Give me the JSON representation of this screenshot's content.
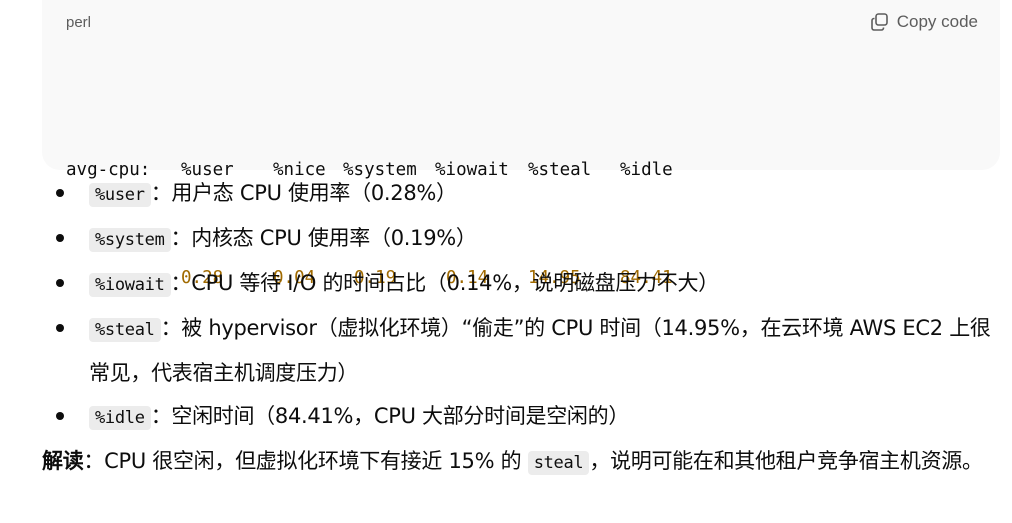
{
  "code_block": {
    "language": "perl",
    "copy_label": "Copy code",
    "icon": "copy-icon",
    "prefix": "avg-cpu:",
    "headers": [
      "%user",
      "%nice",
      "%system",
      "%iowait",
      "%steal",
      "%idle"
    ],
    "values": [
      "0.28",
      "0.04",
      "0.19",
      "0.14",
      "14.95",
      "84.41"
    ],
    "value_color": "#a06a00"
  },
  "bullets": [
    {
      "code": "%user",
      "text": "：用户态 CPU 使用率（0.28%）"
    },
    {
      "code": "%system",
      "text": "：内核态 CPU 使用率（0.19%）"
    },
    {
      "code": "%iowait",
      "text": "：CPU 等待 I/O 的时间占比（0.14%，说明磁盘压力不大）"
    },
    {
      "code": "%steal",
      "text": "：被 hypervisor（虚拟化环境）“偷走”的 CPU 时间（14.95%，在云环境 AWS EC2 上很常见，代表宿主机调度压力）"
    },
    {
      "code": "%idle",
      "text": "：空闲时间（84.41%，CPU 大部分时间是空闲的）"
    }
  ],
  "summary": {
    "label": "解读",
    "text_before": "：CPU 很空闲，但虚拟化环境下有接近 15% 的 ",
    "code": "steal",
    "text_after": "，说明可能在和其他租户竞争宿主机资源。"
  }
}
